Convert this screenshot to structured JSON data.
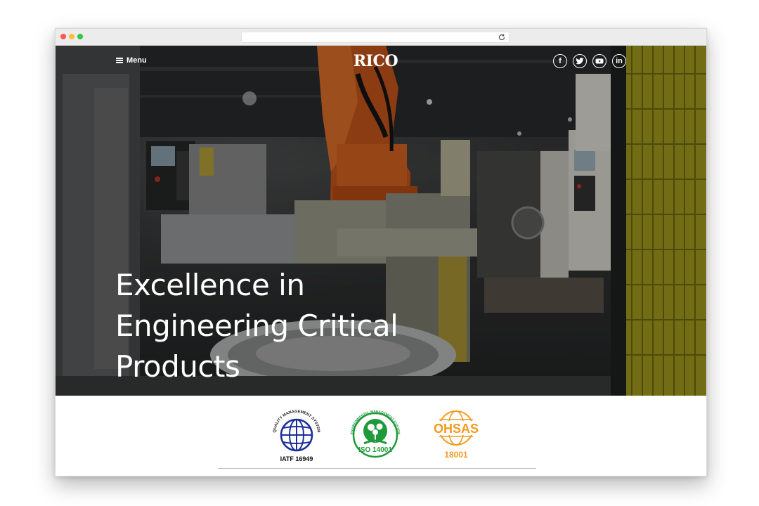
{
  "browser": {
    "reload_icon": "reload-icon"
  },
  "header": {
    "menu_label": "Menu",
    "logo_text": "RICO",
    "social": [
      {
        "name": "facebook",
        "glyph": "f"
      },
      {
        "name": "twitter",
        "glyph": "t"
      },
      {
        "name": "youtube",
        "glyph": "▶"
      },
      {
        "name": "linkedin",
        "glyph": "in"
      }
    ]
  },
  "hero": {
    "headline_line1": "Excellence in",
    "headline_line2": "Engineering Critical",
    "headline_line3": "Products"
  },
  "certifications": {
    "iatf": {
      "arc_text": "QUALITY MANAGEMENT SYSTEM",
      "label": "IATF 16949",
      "color": "#1b2f9b"
    },
    "iso": {
      "arc_text": "ENVIRONMENTAL MANAGEMENT SYSTEM",
      "label": "ISO 14001",
      "color": "#1f9a3a"
    },
    "ohsas": {
      "label_top": "OHSAS",
      "label_bottom": "18001",
      "color": "#f39a1e"
    }
  }
}
